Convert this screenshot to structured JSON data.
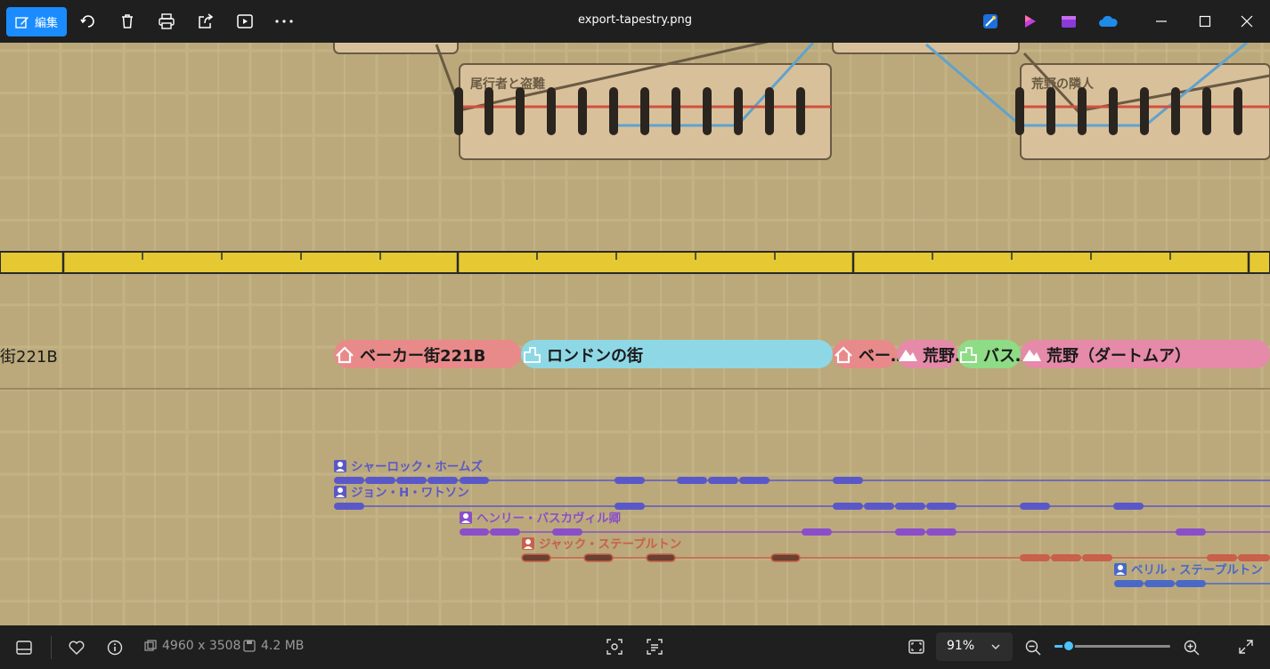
{
  "toolbar": {
    "edit_label": "編集",
    "filename": "export-tapestry.png",
    "icons": [
      "rotate-icon",
      "delete-icon",
      "print-icon",
      "share-icon",
      "slideshow-icon",
      "more-icon"
    ],
    "app_icons": [
      "designer-icon",
      "clipchamp-icon",
      "clipchamp-video-icon",
      "onedrive-icon"
    ],
    "window_buttons": [
      "minimize-icon",
      "maximize-icon",
      "close-icon"
    ]
  },
  "tapestry": {
    "scenes": [
      {
        "title": "尾行者と盗難"
      },
      {
        "title": "荒野の隣人"
      }
    ],
    "place_cut_left": "街221B",
    "places": [
      {
        "name": "ベーカー街221B",
        "color": "#e88a8a",
        "icon": "home-icon"
      },
      {
        "name": "ロンドンの街",
        "color": "#8ed8e6",
        "icon": "city-icon"
      },
      {
        "name": "ベー…",
        "color": "#e88a8a",
        "icon": "home-icon"
      },
      {
        "name": "荒野…",
        "color": "#e68aaa",
        "icon": "mountain-icon"
      },
      {
        "name": "バス…",
        "color": "#8edc86",
        "icon": "city-icon"
      },
      {
        "name": "荒野（ダートムア）",
        "color": "#e68aaa",
        "icon": "mountain-icon"
      }
    ],
    "characters": [
      {
        "name": "シャーロック・ホームズ",
        "color": "#5a58c8"
      },
      {
        "name": "ジョン・H・ワトソン",
        "color": "#5a58c8"
      },
      {
        "name": "ヘンリー・バスカヴィル卿",
        "color": "#8a4fc8"
      },
      {
        "name": "ジャック・ステープルトン",
        "color": "#c8604a"
      },
      {
        "name": "ベリル・ステープルトン",
        "color": "#4a68c8"
      }
    ]
  },
  "statusbar": {
    "dimensions": "4960 x 3508",
    "filesize": "4.2 MB",
    "zoom": "91%",
    "zoom_level": 0.12
  }
}
